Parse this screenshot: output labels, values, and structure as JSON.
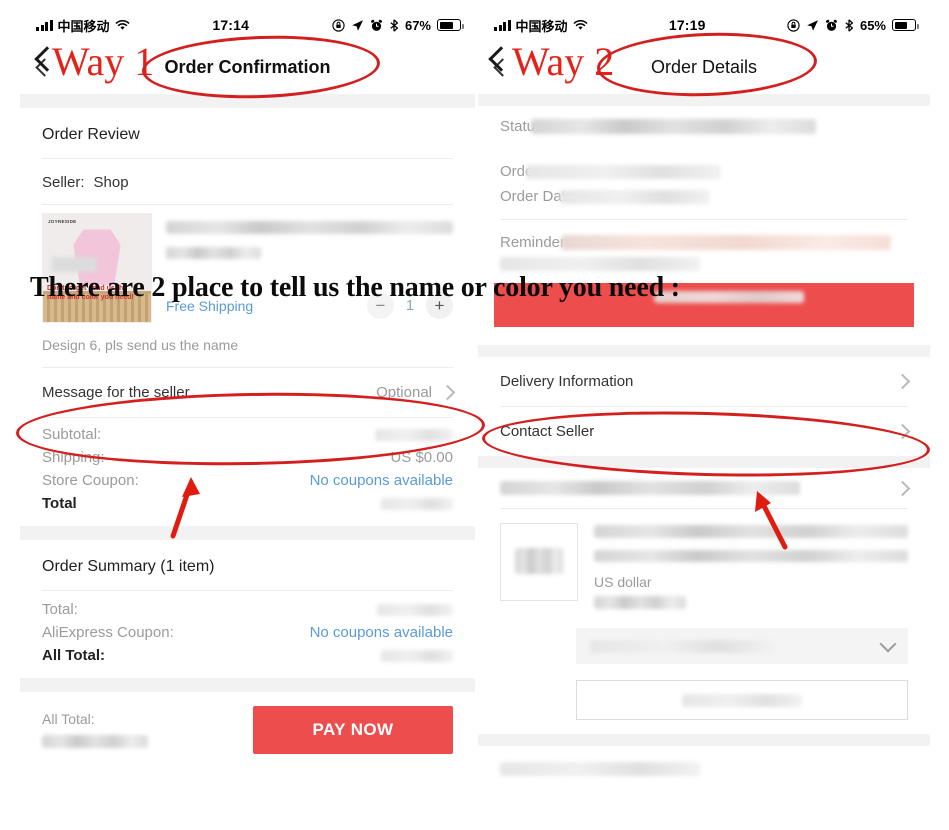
{
  "annotations": {
    "way1_label": "Way 1",
    "way2_label": "Way 2",
    "overlay_text": "There are 2 place to tell us the name or color you need :",
    "accent_color": "#d41f1f",
    "way_color": "#e32219"
  },
  "left_phone": {
    "status_bar": {
      "carrier": "中国移动",
      "time": "17:14",
      "battery_percent": "67%",
      "icons": [
        "signal-icon",
        "wifi-icon",
        "rotation-lock-icon",
        "location-arrow-icon",
        "alarm-clock-icon",
        "bluetooth-icon",
        "battery-icon"
      ]
    },
    "nav": {
      "title": "Order Confirmation",
      "back_icon": "chevron-left-icon"
    },
    "order_review": {
      "heading": "Order Review",
      "seller_label": "Seller:",
      "seller_name": "Shop",
      "thumbnail": {
        "brand": "JOYRESIDE",
        "note": "Don't forget send us the name and color you need!"
      },
      "free_shipping": "Free Shipping",
      "quantity": "1",
      "minus_label": "−",
      "plus_label": "+",
      "description": "Design 6, pls send us the name"
    },
    "message_row": {
      "label": "Message for the seller",
      "value": "Optional",
      "chevron": "chevron-right-icon"
    },
    "price_rows": [
      {
        "label": "Subtotal:",
        "value": "",
        "blurred": true
      },
      {
        "label": "Shipping:",
        "value": "US $0.00",
        "blurred": false
      },
      {
        "label": "Store Coupon:",
        "value": "No coupons available",
        "blurred": false,
        "link": true
      },
      {
        "label": "Total",
        "value": "",
        "blurred": true,
        "bold": true
      }
    ],
    "order_summary": {
      "heading": "Order Summary (1 item)",
      "rows": [
        {
          "label": "Total:",
          "value": "",
          "blurred": true
        },
        {
          "label": "AliExpress Coupon:",
          "value": "No coupons available",
          "blurred": false,
          "link": true
        },
        {
          "label": "All Total:",
          "value": "",
          "blurred": true,
          "bold": true
        }
      ]
    },
    "pay_bar": {
      "all_total_label": "All Total:",
      "all_total_value": "",
      "pay_button": "PAY NOW"
    }
  },
  "right_phone": {
    "status_bar": {
      "carrier": "中国移动",
      "time": "17:19",
      "battery_percent": "65%",
      "icons": [
        "signal-icon",
        "wifi-icon",
        "rotation-lock-icon",
        "location-arrow-icon",
        "alarm-clock-icon",
        "bluetooth-icon",
        "battery-icon"
      ]
    },
    "nav": {
      "title": "Order Details",
      "back_icon": "chevron-left-icon"
    },
    "detail_rows": [
      {
        "label": "Status:",
        "blurred": true
      },
      {
        "label": "Order",
        "blurred": true
      },
      {
        "label": "Order Date",
        "blurred": true
      },
      {
        "label": "Reminder:",
        "blurred": true,
        "tone": "pink"
      }
    ],
    "links": [
      {
        "label": "Delivery Information",
        "chevron": "chevron-right-icon"
      },
      {
        "label": "Contact Seller",
        "chevron": "chevron-right-icon"
      }
    ],
    "product": {
      "currency_note": "US dollar"
    }
  }
}
